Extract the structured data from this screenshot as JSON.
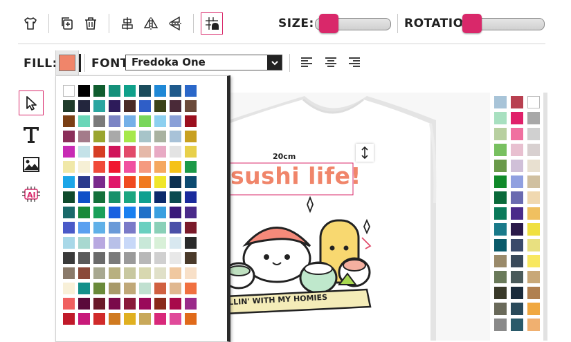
{
  "toolbar": {
    "size_label": "SIZE:",
    "rotation_label": "ROTATION:",
    "fill_label": "FILL:",
    "font_label": "FONT:",
    "font_value": "Fredoka One",
    "fill_color": "#f0856a",
    "size_level": 0.06,
    "rotation_level": 0.0
  },
  "icons": [
    "tshirt-icon",
    "duplicate-icon",
    "trash-icon",
    "align-center-icon",
    "flip-horizontal-icon",
    "flip-vertical-icon",
    "bring-to-front-icon",
    "align-left-icon",
    "align-center-text-icon",
    "align-right-text-icon",
    "select-tool-icon",
    "text-tool-icon",
    "image-tool-icon",
    "ai-tool-icon",
    "resize-icon"
  ],
  "canvas": {
    "size_tag": "20cm",
    "design_title": "sushi life!",
    "banner_text": "LLIN' WITH MY HOMIES"
  },
  "palette_colors": [
    "#ffffff",
    "#000000",
    "#0f5c2e",
    "#14907a",
    "#0fa08a",
    "#1b4c5c",
    "#1f88d6",
    "#1f5a8c",
    "#2a67c9",
    "#1f3b2a",
    "#23263d",
    "#2aa6a0",
    "#2d1b5a",
    "#4a2b25",
    "#2f5ec7",
    "#3b4318",
    "#4a2a38",
    "#6b4a3a",
    "#7a3f14",
    "#6ad6b8",
    "#7a7a7a",
    "#7b84c4",
    "#74b0e8",
    "#79d65a",
    "#8dd0f0",
    "#8aa0d8",
    "#9b0f1e",
    "#8b2f5a",
    "#a47b8a",
    "#9aa52e",
    "#a9a9a9",
    "#a6e84a",
    "#a7c4c9",
    "#a9b2a0",
    "#a8c2d8",
    "#c8a020",
    "#c82bb4",
    "#c4e2e8",
    "#d63d24",
    "#d0145a",
    "#e24a6a",
    "#e5b8a8",
    "#e8aac4",
    "#e3e3e3",
    "#e8d04a",
    "#f0e8a8",
    "#f6f0d6",
    "#f04a3a",
    "#f01830",
    "#f050a0",
    "#f59a80",
    "#f5a860",
    "#f5c218",
    "#1b9a48",
    "#1ba6e8",
    "#2a3a8c",
    "#7a2a8c",
    "#e0186a",
    "#f04a20",
    "#f07a20",
    "#f0e62a",
    "#0c3050",
    "#0c4a70",
    "#0f4a2c",
    "#0f50c8",
    "#13703a",
    "#17916a",
    "#1ba680",
    "#10a090",
    "#0c2a6c",
    "#0a4a50",
    "#1a2a9c",
    "#1a6a6a",
    "#1a8a3a",
    "#1aa05a",
    "#1a60e0",
    "#1a80f0",
    "#2070c8",
    "#3aa0e0",
    "#3a1a7a",
    "#4a2a8a",
    "#4a5ac8",
    "#5aa0f0",
    "#60b0e8",
    "#6a9ad8",
    "#7a7ac8",
    "#6ad0c0",
    "#8ad0b8",
    "#4a50a8",
    "#7a1a2a",
    "#a8d8e8",
    "#a8d8d0",
    "#b8a8e0",
    "#b8c0e8",
    "#c8d8f8",
    "#c8e8d8",
    "#d8f0d8",
    "#d8e8f0",
    "#2a2a2a",
    "#3a3a3a",
    "#5a5a5a",
    "#6a6a6a",
    "#7a7a7a",
    "#9a9a9a",
    "#b8b8b8",
    "#d0d0d0",
    "#e8e8e8",
    "#4a3a2a",
    "#8a7a6a",
    "#8a4a3a",
    "#a8a890",
    "#b8b080",
    "#c8c8a0",
    "#d8d8b0",
    "#e0e0c8",
    "#f0c8a0",
    "#f8e0c8",
    "#f8f0d8",
    "#13908a",
    "#6a8a3a",
    "#a89a6a",
    "#c0a878",
    "#c0e0d0",
    "#d06040",
    "#e0b890",
    "#f07040",
    "#f06060",
    "#5a0a3a",
    "#6a1a2a",
    "#7a0a4a",
    "#8a1a3a",
    "#9a0a5a",
    "#8a2a1a",
    "#a80a4a",
    "#9a2a8a",
    "#c01a2a",
    "#c81a7a",
    "#d02a2a",
    "#d07a20",
    "#e0b020",
    "#c8a85a",
    "#d8287a",
    "#e04a9a",
    "#e06a1a"
  ],
  "right_palette": [
    "#a8c4d8",
    "#b84050",
    "#ffffff",
    "#a8e0c0",
    "#e0206a",
    "#a8a8a8",
    "#b8d0a0",
    "#f070a0",
    "#d0d0d0",
    "#78c060",
    "#e8c0d0",
    "#d8d0d0",
    "#6a9a4a",
    "#d0c0d8",
    "#e8e0d0",
    "#108a2a",
    "#90a0e0",
    "#d0c0a0",
    "#0a6a3a",
    "#6a6ab0",
    "#f0d8b0",
    "#0a7a5a",
    "#4a2a8a",
    "#f0c060",
    "#1a7a8a",
    "#2a1a4a",
    "#f0e040",
    "#0a5a6a",
    "#3a4a6a",
    "#e8e080",
    "#9a8a6a",
    "#3a4a5a",
    "#f8e860",
    "#6a7a5a",
    "#4a5a5a",
    "#c8a878",
    "#3a3a2a",
    "#1a2a3a",
    "#b08050",
    "#6a6a5a",
    "#2a4a5a",
    "#f0a840",
    "#8a8a8a",
    "#2a5a6a",
    "#f0b070"
  ]
}
